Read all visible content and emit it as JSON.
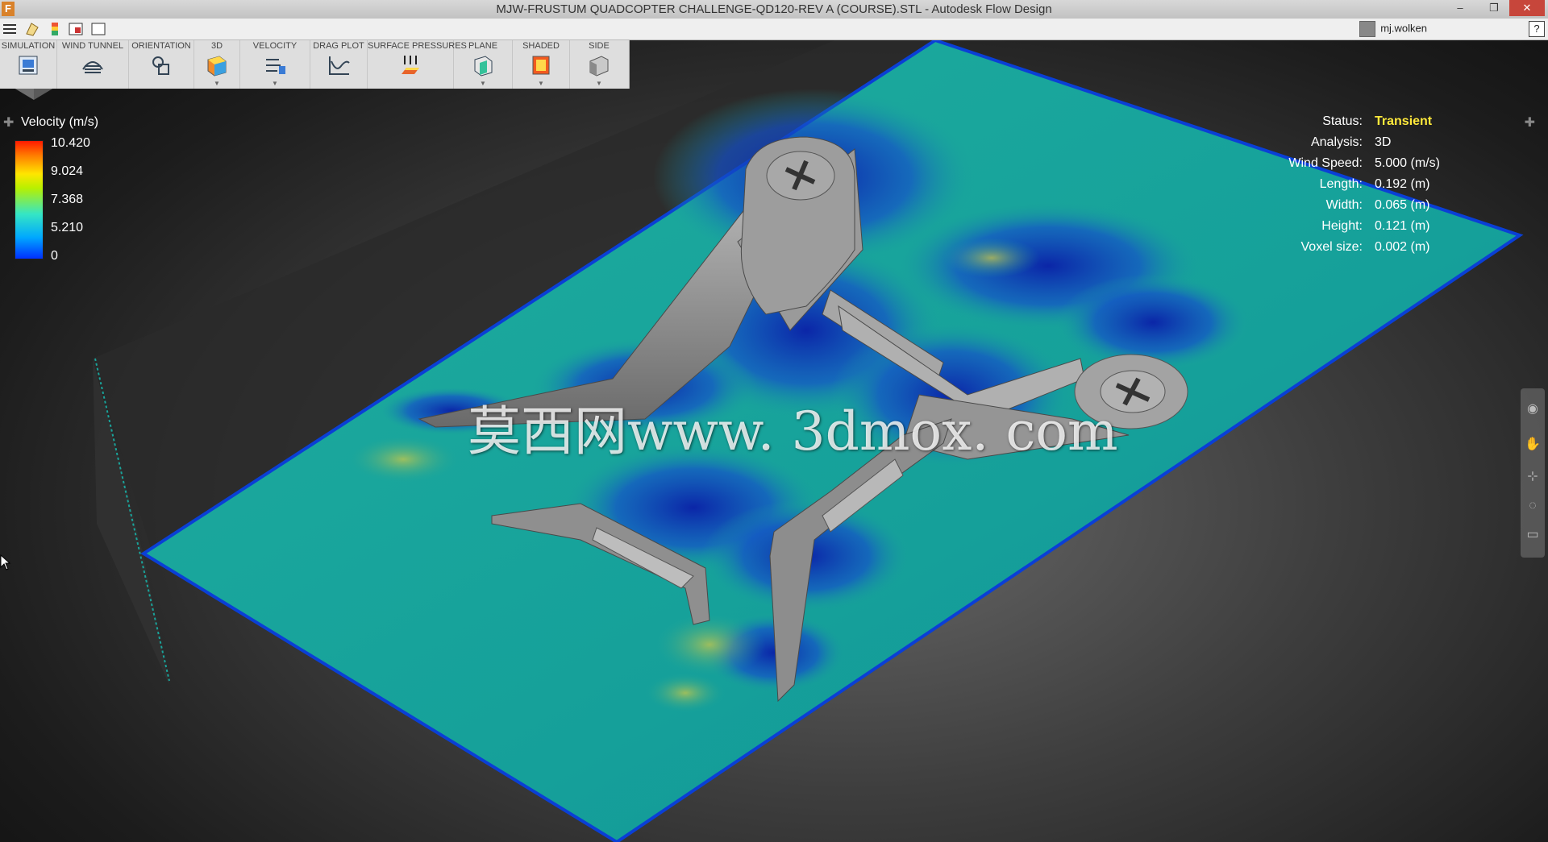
{
  "window": {
    "app_icon_letter": "F",
    "title": "MJW-FRUSTUM QUADCOPTER CHALLENGE-QD120-REV A (COURSE).STL - Autodesk Flow Design",
    "minimize_glyph": "–",
    "restore_glyph": "❐",
    "close_glyph": "✕"
  },
  "quick_toolbar": {
    "icons": [
      "menu-icon",
      "open-icon",
      "colors-icon",
      "layout-icon",
      "window-icon"
    ],
    "user_name": "mj.wolken",
    "help_label": "?"
  },
  "ribbon": {
    "buttons": [
      {
        "label": "SIMULATION",
        "icon": "simulation-icon",
        "has_dropdown": false
      },
      {
        "label": "WIND TUNNEL",
        "icon": "wind-tunnel-icon",
        "has_dropdown": false
      },
      {
        "label": "ORIENTATION",
        "icon": "orientation-icon",
        "has_dropdown": false
      },
      {
        "label": "3D",
        "icon": "3d-icon",
        "has_dropdown": true
      },
      {
        "label": "VELOCITY",
        "icon": "velocity-icon",
        "has_dropdown": true
      },
      {
        "label": "DRAG PLOT",
        "icon": "drag-plot-icon",
        "has_dropdown": false
      },
      {
        "label": "SURFACE PRESSURES",
        "icon": "surface-pressures-icon",
        "has_dropdown": false
      },
      {
        "label": "PLANE",
        "icon": "plane-icon",
        "has_dropdown": true
      },
      {
        "label": "SHADED",
        "icon": "shaded-icon",
        "has_dropdown": true
      },
      {
        "label": "SIDE",
        "icon": "side-view-icon",
        "has_dropdown": true
      }
    ]
  },
  "legend": {
    "title": "Velocity (m/s)",
    "ticks": [
      "10.420",
      "9.024",
      "7.368",
      "5.210",
      "0"
    ],
    "colors": [
      "#ff1a00",
      "#ffe600",
      "#35e6c4",
      "#00a8ff",
      "#0030ff"
    ]
  },
  "status_panel": {
    "rows": [
      {
        "key": "Status:",
        "value": "Transient"
      },
      {
        "key": "Analysis:",
        "value": "3D"
      },
      {
        "key": "Wind Speed:",
        "value": "5.000 (m/s)"
      },
      {
        "key": "Length:",
        "value": "0.192 (m)"
      },
      {
        "key": "Width:",
        "value": "0.065 (m)"
      },
      {
        "key": "Height:",
        "value": "0.121 (m)"
      },
      {
        "key": "Voxel size:",
        "value": "0.002 (m)"
      }
    ],
    "status_color": "#ffe93b"
  },
  "watermark": "莫西网www. 3dmox. com",
  "colors": {
    "flow_plane": "#1aa39a",
    "plane_border": "#0a3fd6",
    "low_velocity": "#0a3fb0",
    "model_gray": "#8c8c8c"
  }
}
